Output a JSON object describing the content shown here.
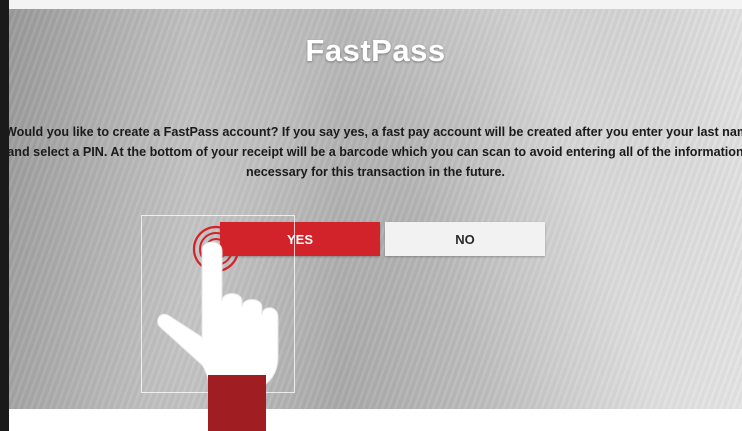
{
  "dialog": {
    "title": "FastPass",
    "message_line_1": "Would you like to create a FastPass account? If you say yes, a fast pay account will be created after you enter your last name",
    "message_line_2": "and select a PIN. At the bottom of your receipt will be a barcode which you can scan to avoid entering all of the information",
    "message_line_3": "necessary for this transaction in the future.",
    "yes_label": "YES",
    "no_label": "NO"
  },
  "colors": {
    "accent": "#d2232a",
    "hand_cuff": "#a01e22",
    "button_secondary": "#f2f2f2"
  },
  "icons": {
    "tap_hint": "pointing-hand-icon",
    "tap_ripple": "tap-ripple-icon"
  }
}
